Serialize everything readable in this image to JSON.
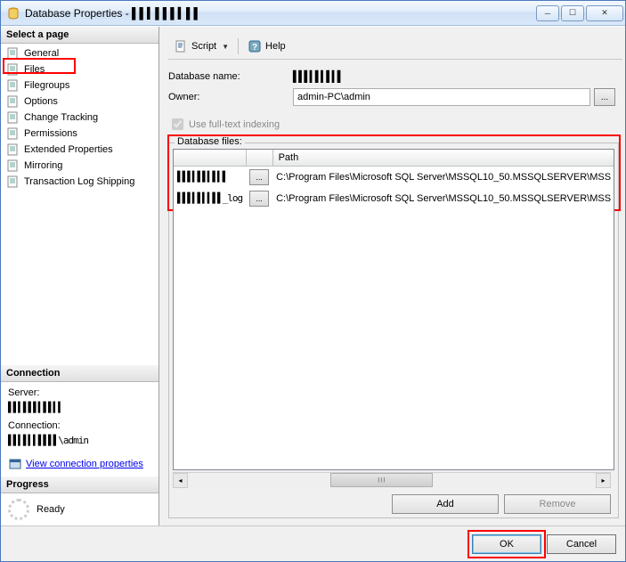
{
  "window": {
    "title": "Database Properties - ▌▌▍▌▌▌▍▌▌"
  },
  "sidebar": {
    "select_page": "Select a page",
    "pages": [
      {
        "label": "General"
      },
      {
        "label": "Files"
      },
      {
        "label": "Filegroups"
      },
      {
        "label": "Options"
      },
      {
        "label": "Change Tracking"
      },
      {
        "label": "Permissions"
      },
      {
        "label": "Extended Properties"
      },
      {
        "label": "Mirroring"
      },
      {
        "label": "Transaction Log Shipping"
      }
    ],
    "connection_header": "Connection",
    "server_label": "Server:",
    "server_value": "▌▌▍▌▌▌▍▌▌▍▍",
    "connection_label": "Connection:",
    "connection_value": "▌▌▍▌▍▍▌▌▌▌\\admin",
    "view_conn_props": "View connection properties",
    "progress_header": "Progress",
    "progress_status": "Ready"
  },
  "toolbar": {
    "script": "Script",
    "help": "Help"
  },
  "form": {
    "db_name_label": "Database name:",
    "db_name_value": "▌▌▌▍▌▍▌▍▌",
    "owner_label": "Owner:",
    "owner_value": "admin-PC\\admin",
    "fulltext_label": "Use full-text indexing"
  },
  "files": {
    "legend": "Database files:",
    "col_name": "",
    "col_browse": "",
    "col_path": "Path",
    "rows": [
      {
        "name": "▌▌▌▍▌▌▍▌▍▌",
        "path": "C:\\Program Files\\Microsoft SQL Server\\MSSQL10_50.MSSQLSERVER\\MSS"
      },
      {
        "name": "▌▌▌▍▌▍▍▌▌_log",
        "path": "C:\\Program Files\\Microsoft SQL Server\\MSSQL10_50.MSSQLSERVER\\MSS"
      }
    ],
    "add_button": "Add",
    "remove_button": "Remove"
  },
  "footer": {
    "ok": "OK",
    "cancel": "Cancel"
  }
}
